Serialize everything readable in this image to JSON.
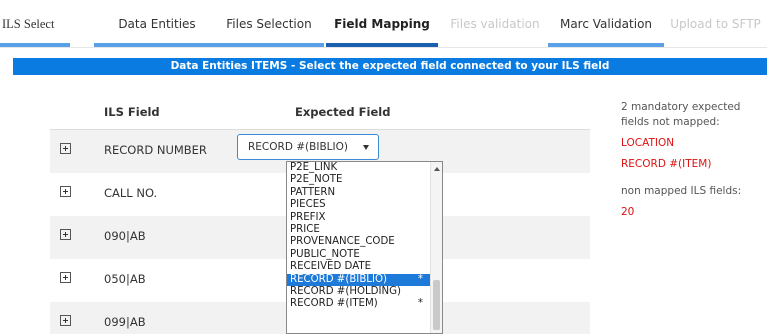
{
  "tabs": [
    {
      "label": "ILS Select",
      "state": "done"
    },
    {
      "label": "Data Entities",
      "state": "done"
    },
    {
      "label": "Files Selection",
      "state": "done"
    },
    {
      "label": "Field Mapping",
      "state": "current"
    },
    {
      "label": "Files validation",
      "state": "disabled"
    },
    {
      "label": "Marc Validation",
      "state": "done"
    },
    {
      "label": "Upload to SFTP",
      "state": "disabled"
    }
  ],
  "section": {
    "title": "Data Entities ITEMS - Select the expected field connected to your ILS field"
  },
  "table": {
    "col_ils": "ILS Field",
    "col_expected": "Expected Field",
    "rows": [
      {
        "ils": "RECORD NUMBER"
      },
      {
        "ils": "CALL NO."
      },
      {
        "ils": "090|AB"
      },
      {
        "ils": "050|AB"
      },
      {
        "ils": "099|AB"
      }
    ]
  },
  "select": {
    "value": "RECORD #(BIBLIO)"
  },
  "dropdown": {
    "options": [
      "P2E_LINK",
      "P2E_NOTE",
      "PATTERN",
      "PIECES",
      "PREFIX",
      "PRICE",
      "PROVENANCE_CODE",
      "PUBLIC_NOTE",
      "RECEIVED DATE",
      "RECORD #(BIBLIO)",
      "RECORD #(HOLDING)",
      "RECORD #(ITEM)"
    ],
    "selected": "RECORD #(BIBLIO)",
    "option_marks": [
      "",
      "",
      "",
      "",
      "",
      "",
      "",
      "",
      "",
      "*",
      "",
      "*"
    ]
  },
  "summary": {
    "mandatory_text": "2 mandatory expected fields not mapped:",
    "mandatory_fields": [
      "LOCATION",
      "RECORD #(ITEM)"
    ],
    "non_mapped_text": "non mapped ILS fields:",
    "non_mapped_count": "20"
  },
  "colors": {
    "accent": "#0a7be0",
    "current_step": "#1a5fb0",
    "done_step": "#5aa0e6",
    "warning": "#dd1111"
  }
}
